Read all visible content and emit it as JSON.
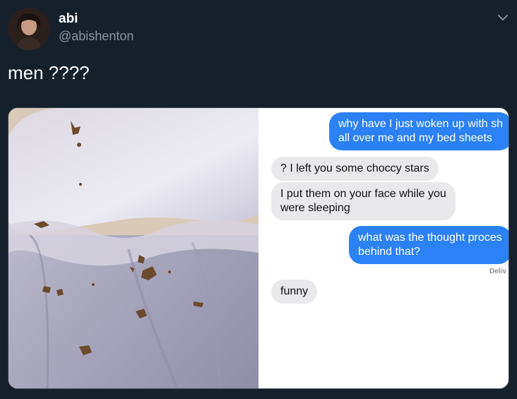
{
  "user": {
    "display_name": "abi",
    "handle": "@abishenton"
  },
  "icons": {
    "menu": "chevron-down-icon",
    "avatar": "profile-photo"
  },
  "tweet": {
    "text": "men ????"
  },
  "chat": {
    "messages": [
      {
        "direction": "outgoing",
        "lines": [
          "why have I just woken up with sh",
          "all over me and my bed sheets"
        ]
      },
      {
        "direction": "incoming",
        "lines": [
          "? I left you some choccy stars"
        ]
      },
      {
        "direction": "incoming",
        "lines": [
          "I put them on your face while you",
          "were sleeping"
        ]
      },
      {
        "direction": "outgoing",
        "lines": [
          "what was the thought proces",
          "behind that?"
        ]
      },
      {
        "direction": "incoming",
        "lines": [
          "funny"
        ]
      }
    ],
    "status": "Deliv"
  },
  "colors": {
    "background": "#15202b",
    "outgoing_bubble": "#2b81f6",
    "incoming_bubble": "#e9e9eb",
    "secondary_text": "#8899a6"
  }
}
